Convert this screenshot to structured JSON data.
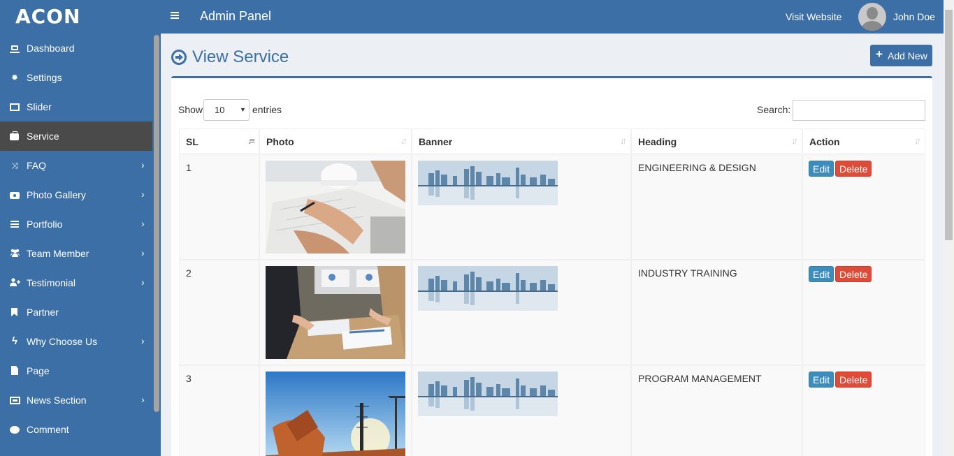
{
  "header": {
    "logo": "ACON",
    "panel_title": "Admin Panel",
    "visit_website": "Visit Website",
    "user_name": "John Doe"
  },
  "sidebar": {
    "items": [
      {
        "label": "Dashboard",
        "icon": "laptop-icon",
        "has_submenu": false
      },
      {
        "label": "Settings",
        "icon": "gear-icon",
        "has_submenu": false
      },
      {
        "label": "Slider",
        "icon": "image-icon",
        "has_submenu": false
      },
      {
        "label": "Service",
        "icon": "briefcase-icon",
        "has_submenu": false,
        "active": true
      },
      {
        "label": "FAQ",
        "icon": "random-icon",
        "has_submenu": true
      },
      {
        "label": "Photo Gallery",
        "icon": "camera-icon",
        "has_submenu": true
      },
      {
        "label": "Portfolio",
        "icon": "bars-icon",
        "has_submenu": true
      },
      {
        "label": "Team Member",
        "icon": "users-icon",
        "has_submenu": true
      },
      {
        "label": "Testimonial",
        "icon": "user-plus-icon",
        "has_submenu": true
      },
      {
        "label": "Partner",
        "icon": "bookmark-icon",
        "has_submenu": false
      },
      {
        "label": "Why Choose Us",
        "icon": "bolt-icon",
        "has_submenu": true
      },
      {
        "label": "Page",
        "icon": "file-icon",
        "has_submenu": false
      },
      {
        "label": "News Section",
        "icon": "newspaper-icon",
        "has_submenu": true
      },
      {
        "label": "Comment",
        "icon": "comment-icon",
        "has_submenu": false
      }
    ]
  },
  "page": {
    "title": "View Service",
    "add_new": "Add New"
  },
  "table_controls": {
    "show_label": "Show",
    "entries_value": "10",
    "entries_label": "entries",
    "search_label": "Search:",
    "search_value": ""
  },
  "table": {
    "columns": [
      "SL",
      "Photo",
      "Banner",
      "Heading",
      "Action"
    ],
    "rows": [
      {
        "sl": "1",
        "heading": "ENGINEERING & DESIGN"
      },
      {
        "sl": "2",
        "heading": "INDUSTRY TRAINING"
      },
      {
        "sl": "3",
        "heading": "PROGRAM MANAGEMENT"
      }
    ],
    "edit_label": "Edit",
    "delete_label": "Delete"
  },
  "colors": {
    "primary": "#3c6fa5",
    "active_menu": "#4b4a4a",
    "edit": "#3c8dbc",
    "delete": "#dd4b39"
  }
}
